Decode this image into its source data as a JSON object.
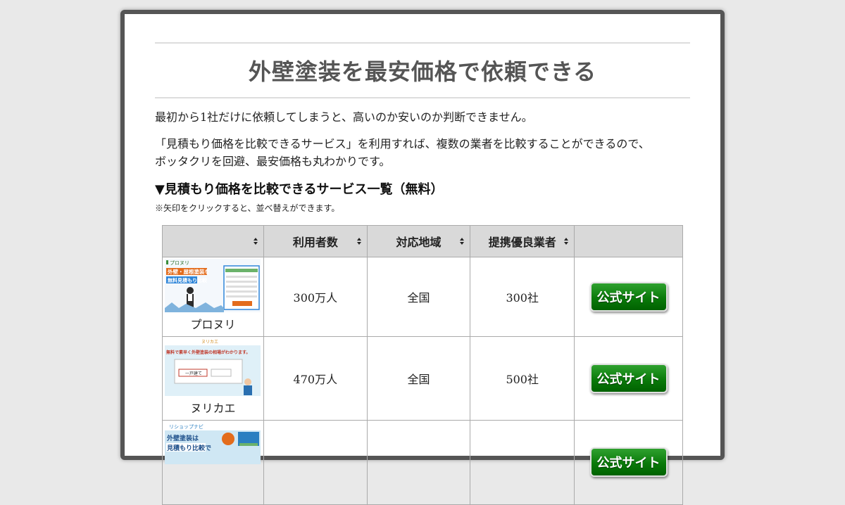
{
  "page": {
    "title": "外壁塗装を最安価格で依頼できる",
    "para1": "最初から1社だけに依頼してしまうと、高いのか安いのか判断できません。",
    "para2_line1": "「見積もり価格を比較できるサービス」を利用すれば、複数の業者を比較することができるので、",
    "para2_line2": "ボッタクリを回避、最安価格も丸わかりです。",
    "list_heading": "▼見積もり価格を比較できるサービス一覧（無料）",
    "sort_note": "※矢印をクリックすると、並べ替えができます。"
  },
  "table": {
    "headers": [
      "",
      "利用者数",
      "対応地域",
      "提携優良業者",
      ""
    ],
    "rows": [
      {
        "name": "プロヌリ",
        "users": "300万人",
        "region": "全国",
        "partners": "300社",
        "button": "公式サイト",
        "thumb_text": {
          "logo": "プロヌリ",
          "headline": "外壁・屋根塗装を",
          "sub": "無料見積もり比較"
        }
      },
      {
        "name": "ヌリカエ",
        "users": "470万人",
        "region": "全国",
        "partners": "500社",
        "button": "公式サイト",
        "thumb_text": {
          "logo": "ヌリカエ",
          "headline": "無料で素早く外壁塗装の相場がわかります。",
          "sub": "一戸建て"
        }
      },
      {
        "name": "",
        "users": "",
        "region": "",
        "partners": "",
        "button": "公式サイト",
        "thumb_text": {
          "logo": "リショップナビ",
          "headline": "外壁塗装は",
          "sub": "見積もり比較で"
        }
      }
    ]
  },
  "colors": {
    "button_green": "#0a7a0a",
    "frame": "#555555",
    "header_bg": "#d9d9d9"
  }
}
